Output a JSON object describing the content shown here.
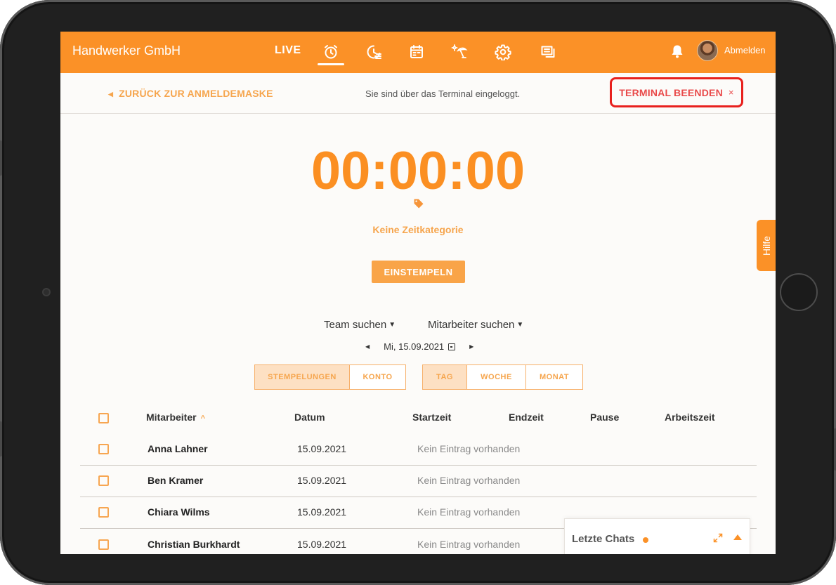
{
  "app": {
    "company_name": "Handwerker GmbH",
    "live_label": "LIVE",
    "logout_label": "Abmelden",
    "accent_color": "#fb9127",
    "nav_icons": [
      "alarm-clock-icon",
      "time-history-icon",
      "calendar-icon",
      "vacation-icon",
      "settings-icon",
      "messages-icon"
    ],
    "active_nav": "alarm-clock-icon"
  },
  "terminal": {
    "back_label": "ZURÜCK ZUR ANMELDEMASKE",
    "info_text": "Sie sind über das Terminal eingeloggt.",
    "end_label": "TERMINAL BEENDEN",
    "end_close": "×",
    "highlight_color": "#e8201d"
  },
  "timer": {
    "display": "00:00:00",
    "category": "Keine Zeitkategorie",
    "clock_in_label": "EINSTEMPELN"
  },
  "filters": {
    "team_search": "Team suchen",
    "employee_search": "Mitarbeiter suchen",
    "date": "Mi, 15.09.2021"
  },
  "view_toggle": {
    "left": [
      {
        "label": "STEMPELUNGEN",
        "active": true
      },
      {
        "label": "KONTO",
        "active": false
      }
    ],
    "right": [
      {
        "label": "TAG",
        "active": true
      },
      {
        "label": "WOCHE",
        "active": false
      },
      {
        "label": "MONAT",
        "active": false
      }
    ]
  },
  "table": {
    "headers": {
      "employee": "Mitarbeiter",
      "date": "Datum",
      "start": "Startzeit",
      "end": "Endzeit",
      "break": "Pause",
      "work_time": "Arbeitszeit"
    },
    "rows": [
      {
        "name": "Anna Lahner",
        "date": "15.09.2021",
        "status": "Kein Eintrag vorhanden"
      },
      {
        "name": "Ben Kramer",
        "date": "15.09.2021",
        "status": "Kein Eintrag vorhanden"
      },
      {
        "name": "Chiara Wilms",
        "date": "15.09.2021",
        "status": "Kein Eintrag vorhanden"
      },
      {
        "name": "Christian Burkhardt",
        "date": "15.09.2021",
        "status": "Kein Eintrag vorhanden"
      }
    ]
  },
  "help_tab": {
    "label": "Hilfe"
  },
  "chats": {
    "title": "Letzte Chats"
  }
}
